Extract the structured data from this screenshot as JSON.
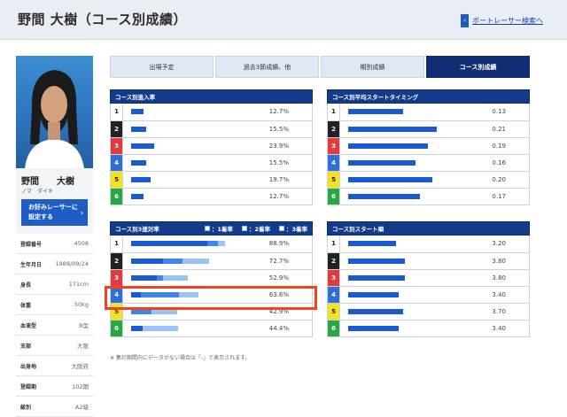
{
  "header": {
    "title": "野間 大樹（コース別成績）",
    "search_link": "ボートレーサー検索へ"
  },
  "profile": {
    "name": "野間　　大樹",
    "kana": "ノマ　ダイキ",
    "fav_button": [
      "お好みレーサーに",
      "設定する"
    ],
    "info": [
      {
        "k": "登録番号",
        "v": "4508"
      },
      {
        "k": "生年月日",
        "v": "1988/09/24"
      },
      {
        "k": "身長",
        "v": "171cm"
      },
      {
        "k": "体重",
        "v": "50kg"
      },
      {
        "k": "血液型",
        "v": "B型"
      },
      {
        "k": "支部",
        "v": "大阪"
      },
      {
        "k": "出身地",
        "v": "大阪府"
      },
      {
        "k": "登録期",
        "v": "102期"
      },
      {
        "k": "級別",
        "v": "A2級"
      }
    ]
  },
  "tabs": [
    {
      "label": "出場予定",
      "active": false
    },
    {
      "label": "過去3節成績、他",
      "active": false
    },
    {
      "label": "期別成績",
      "active": false
    },
    {
      "label": "コース別成績",
      "active": true
    }
  ],
  "panels": {
    "entry": {
      "title": "コース別進入率",
      "rows": [
        {
          "course": "1",
          "value": "12.7%",
          "level": 0.127
        },
        {
          "course": "2",
          "value": "15.5%",
          "level": 0.155
        },
        {
          "course": "3",
          "value": "23.9%",
          "level": 0.239
        },
        {
          "course": "4",
          "value": "15.5%",
          "level": 0.155
        },
        {
          "course": "5",
          "value": "19.7%",
          "level": 0.197
        },
        {
          "course": "6",
          "value": "12.7%",
          "level": 0.127
        }
      ]
    },
    "timing": {
      "title": "コース別平均スタートタイミング",
      "rows": [
        {
          "course": "1",
          "value": "0.13",
          "level": 0.13
        },
        {
          "course": "2",
          "value": "0.21",
          "level": 0.21
        },
        {
          "course": "3",
          "value": "0.19",
          "level": 0.19
        },
        {
          "course": "4",
          "value": "0.16",
          "level": 0.16
        },
        {
          "course": "5",
          "value": "0.20",
          "level": 0.2
        },
        {
          "course": "6",
          "value": "0.17",
          "level": 0.17
        }
      ]
    },
    "rentai": {
      "title": "コース別3連対率",
      "legend": [
        "：1着率",
        "：2着率",
        "：3着率"
      ],
      "rows": [
        {
          "course": "1",
          "value": "88.9%",
          "parts": [
            0.72,
            0.1,
            0.07
          ]
        },
        {
          "course": "2",
          "value": "72.7%",
          "parts": [
            0.3,
            0.18,
            0.25
          ]
        },
        {
          "course": "3",
          "value": "52.9%",
          "parts": [
            0.24,
            0.06,
            0.23
          ]
        },
        {
          "course": "4",
          "value": "63.6%",
          "parts": [
            0.09,
            0.36,
            0.18
          ]
        },
        {
          "course": "5",
          "value": "42.9%",
          "parts": [
            0.0,
            0.19,
            0.24
          ]
        },
        {
          "course": "6",
          "value": "44.4%",
          "parts": [
            0.11,
            0.0,
            0.33
          ]
        }
      ]
    },
    "start_rank": {
      "title": "コース別スタート順",
      "rows": [
        {
          "course": "1",
          "value": "3.20",
          "level": 3.2
        },
        {
          "course": "2",
          "value": "3.80",
          "level": 3.8
        },
        {
          "course": "3",
          "value": "3.80",
          "level": 3.8
        },
        {
          "course": "4",
          "value": "3.40",
          "level": 3.4
        },
        {
          "course": "5",
          "value": "3.70",
          "level": 3.7
        },
        {
          "course": "6",
          "value": "3.40",
          "level": 3.4
        }
      ]
    }
  },
  "note": "※ 集計期間内にデータがない場合は「-」で表示されます。",
  "colors": {
    "header_bg": "#e9eef5",
    "panel_header": "#143b8a",
    "tab_active": "#0f2d72",
    "bar_primary": "#1a5bd1",
    "highlight": "#f0431e"
  }
}
